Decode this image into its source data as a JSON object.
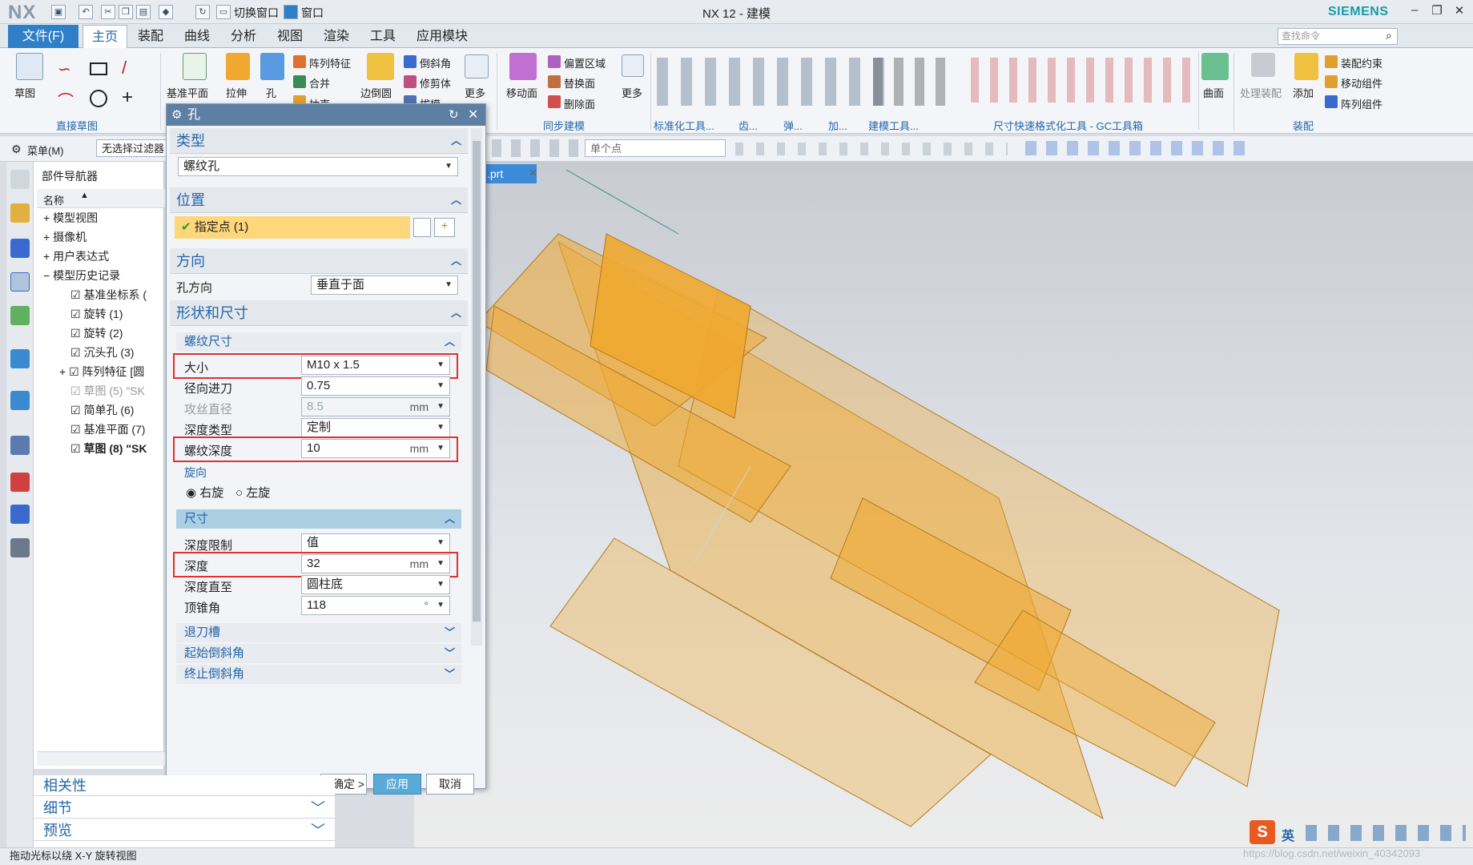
{
  "app": {
    "logo": "NX",
    "title": "NX 12 - 建模",
    "brand": "SIEMENS",
    "quick": {
      "switch_window": "切换窗口",
      "window": "窗口"
    }
  },
  "menu": {
    "file": "文件(F)",
    "tabs": [
      "主页",
      "装配",
      "曲线",
      "分析",
      "视图",
      "渲染",
      "工具",
      "应用模块"
    ],
    "search_placeholder": "查找命令"
  },
  "ribbon": {
    "sketch": "草图",
    "group_direct_sketch": "直接草图",
    "datum": "基准平面",
    "extrude": "拉伸",
    "hole": "孔",
    "pattern": "阵列特征",
    "unite": "合并",
    "shell": "抽壳",
    "edge_blend": "边倒圆",
    "chamfer": "倒斜角",
    "trim_body": "修剪体",
    "draft": "拔模",
    "more1": "更多",
    "move_face": "移动面",
    "offset_region": "偏置区域",
    "replace_face": "替换面",
    "delete_face": "删除面",
    "more2": "更多",
    "group_sync": "同步建模",
    "group_std": "标准化工具...",
    "group_gear": "齿...",
    "group_spring": "弹...",
    "group_add": "加...",
    "group_modeling_tools": "建模工具...",
    "group_dim": "尺寸快速格式化工具 - GC工具箱",
    "surface": "曲面",
    "process_assembly": "处理装配",
    "add": "添加",
    "asm_constraint": "装配约束",
    "move_component": "移动组件",
    "pattern_component": "阵列组件",
    "group_assembly": "装配"
  },
  "toolbar2": {
    "menu": "菜单(M)",
    "filter": "无选择过滤器",
    "point_type": "单个点"
  },
  "navigator": {
    "title": "部件导航器",
    "col_name": "名称",
    "items": [
      "模型视图",
      "摄像机",
      "用户表达式",
      "模型历史记录",
      "基准坐标系 (",
      "旋转 (1)",
      "旋转 (2)",
      "沉头孔 (3)",
      "阵列特征 [圆",
      "草图 (5) \"SK",
      "简单孔 (6)",
      "基准平面 (7)",
      "草图 (8) \"SK"
    ]
  },
  "file_tab": ".prt",
  "dialog": {
    "title": "孔",
    "type_section": "类型",
    "type_value": "螺纹孔",
    "position_section": "位置",
    "specify_point": "指定点 (1)",
    "direction_section": "方向",
    "hole_dir_label": "孔方向",
    "hole_dir_value": "垂直于面",
    "shape_section": "形状和尺寸",
    "thread_sub": "螺纹尺寸",
    "size_label": "大小",
    "size_value": "M10 x 1.5",
    "radial_label": "径向进刀",
    "radial_value": "0.75",
    "tap_label": "攻丝直径",
    "tap_value": "8.5",
    "tap_unit": "mm",
    "depth_type_label": "深度类型",
    "depth_type_value": "定制",
    "thread_depth_label": "螺纹深度",
    "thread_depth_value": "10",
    "thread_depth_unit": "mm",
    "rotation_label": "旋向",
    "right": "右旋",
    "left": "左旋",
    "dim_sub": "尺寸",
    "depth_limit_label": "深度限制",
    "depth_limit_value": "值",
    "depth_label": "深度",
    "depth_value": "32",
    "depth_unit": "mm",
    "depth_to_label": "深度直至",
    "depth_to_value": "圆柱底",
    "tip_label": "顶锥角",
    "tip_value": "118",
    "tip_unit": "°",
    "relief": "退刀槽",
    "start_chamfer": "起始倒斜角",
    "end_chamfer": "终止倒斜角",
    "ok": "< 确定 >",
    "apply": "应用",
    "cancel": "取消"
  },
  "bottom_panel": [
    "相关性",
    "细节",
    "预览"
  ],
  "status": "拖动光标以绕 X-Y 旋转视图",
  "ime": {
    "lang": "英"
  },
  "watermark": "https://blog.csdn.net/weixin_40342093",
  "colors": {
    "accent": "#2f7fc8",
    "dialog_header": "#5c7fa3",
    "highlight": "#e03030",
    "model": "#f0a830"
  }
}
